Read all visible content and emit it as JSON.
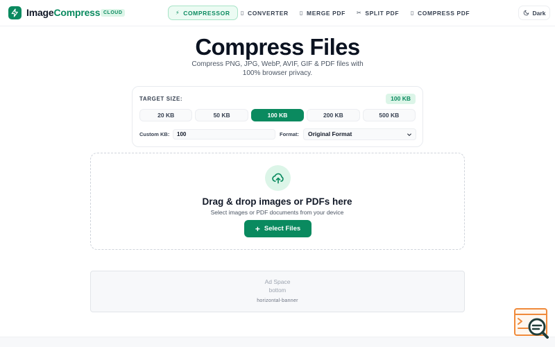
{
  "brand": {
    "name_part1": "Image",
    "name_part2": "Compress",
    "badge": "CLOUD"
  },
  "nav": [
    {
      "label": "COMPRESSOR",
      "icon": "lightning-icon",
      "glyph": "⚡",
      "active": true
    },
    {
      "label": "CONVERTER",
      "icon": "file-icon",
      "glyph": "▯",
      "active": false
    },
    {
      "label": "MERGE PDF",
      "icon": "file-icon",
      "glyph": "▯",
      "active": false
    },
    {
      "label": "SPLIT PDF",
      "icon": "scissors-icon",
      "glyph": "✂",
      "active": false
    },
    {
      "label": "COMPRESS PDF",
      "icon": "file-icon",
      "glyph": "▯",
      "active": false
    }
  ],
  "theme_toggle": {
    "label": "Dark",
    "icon": "moon-icon"
  },
  "hero": {
    "title": "Compress Files",
    "subtitle": "Compress PNG, JPG, WebP, AVIF, GIF & PDF files with 100% browser privacy."
  },
  "settings": {
    "target_label": "TARGET SIZE:",
    "target_value": "100 KB",
    "sizes": [
      {
        "label": "20 KB",
        "active": false
      },
      {
        "label": "50 KB",
        "active": false
      },
      {
        "label": "100 KB",
        "active": true
      },
      {
        "label": "200 KB",
        "active": false
      },
      {
        "label": "500 KB",
        "active": false
      }
    ],
    "custom_label": "Custom KB:",
    "custom_value": "100",
    "format_label": "Format:",
    "format_value": "Original Format"
  },
  "dropzone": {
    "icon": "upload-cloud-icon",
    "title": "Drag & drop images or PDFs here",
    "subtitle": "Select images or PDF documents from your device",
    "button_label": "Select Files",
    "button_icon": "plus-icon"
  },
  "ad": {
    "title": "Ad Space",
    "position": "bottom",
    "format": "horizontal-banner"
  },
  "colors": {
    "accent": "#0a8a5f",
    "accent_light": "#dcf5e8",
    "text": "#111827",
    "muted": "#4b5563"
  }
}
